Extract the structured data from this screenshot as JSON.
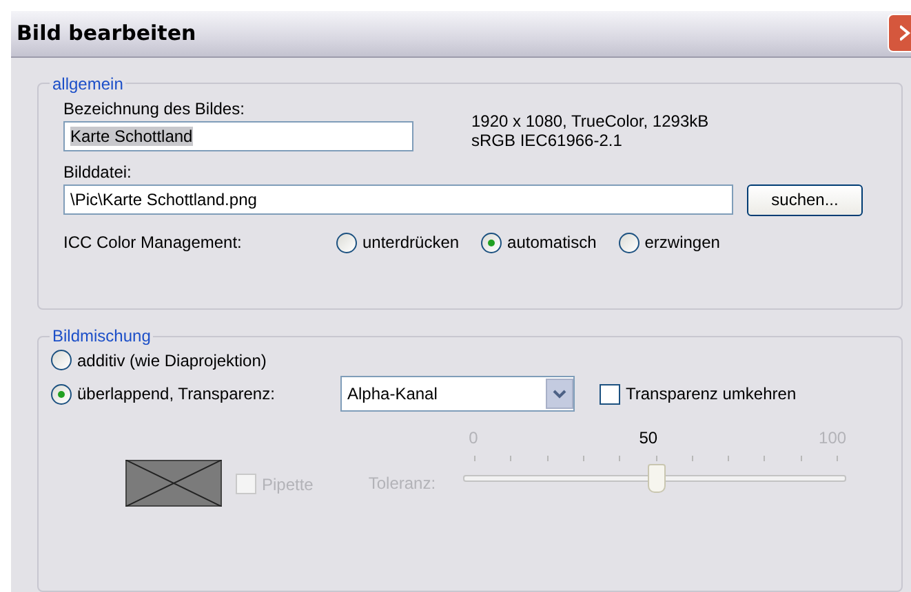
{
  "window": {
    "title": "Bild bearbeiten"
  },
  "general": {
    "legend": "allgemein",
    "name_label": "Bezeichnung des Bildes:",
    "name_value": "Karte Schottland",
    "info": [
      "1920 x 1080, TrueColor, 1293kB",
      "sRGB IEC61966-2.1"
    ],
    "file_label": "Bilddatei:",
    "file_value": "\\Pic\\Karte Schottland.png",
    "browse_button": "suchen...",
    "icc_label": "ICC Color Management:",
    "icc_options": [
      {
        "label": "unterdrücken",
        "selected": false
      },
      {
        "label": "automatisch",
        "selected": true
      },
      {
        "label": "erzwingen",
        "selected": false
      }
    ]
  },
  "blend": {
    "legend": "Bildmischung",
    "modes": [
      {
        "label": "additiv (wie Diaprojektion)",
        "selected": false
      },
      {
        "label": "überlappend, Transparenz:",
        "selected": true
      }
    ],
    "transparency_select": "Alpha-Kanal",
    "invert": {
      "label": "Transparenz umkehren",
      "checked": false
    },
    "pipette": {
      "label": "Pipette",
      "checked": false,
      "disabled": true
    },
    "tolerance": {
      "label": "Toleranz:",
      "min": "0",
      "value": "50",
      "max": "100",
      "level": 0.5,
      "disabled": true
    }
  }
}
